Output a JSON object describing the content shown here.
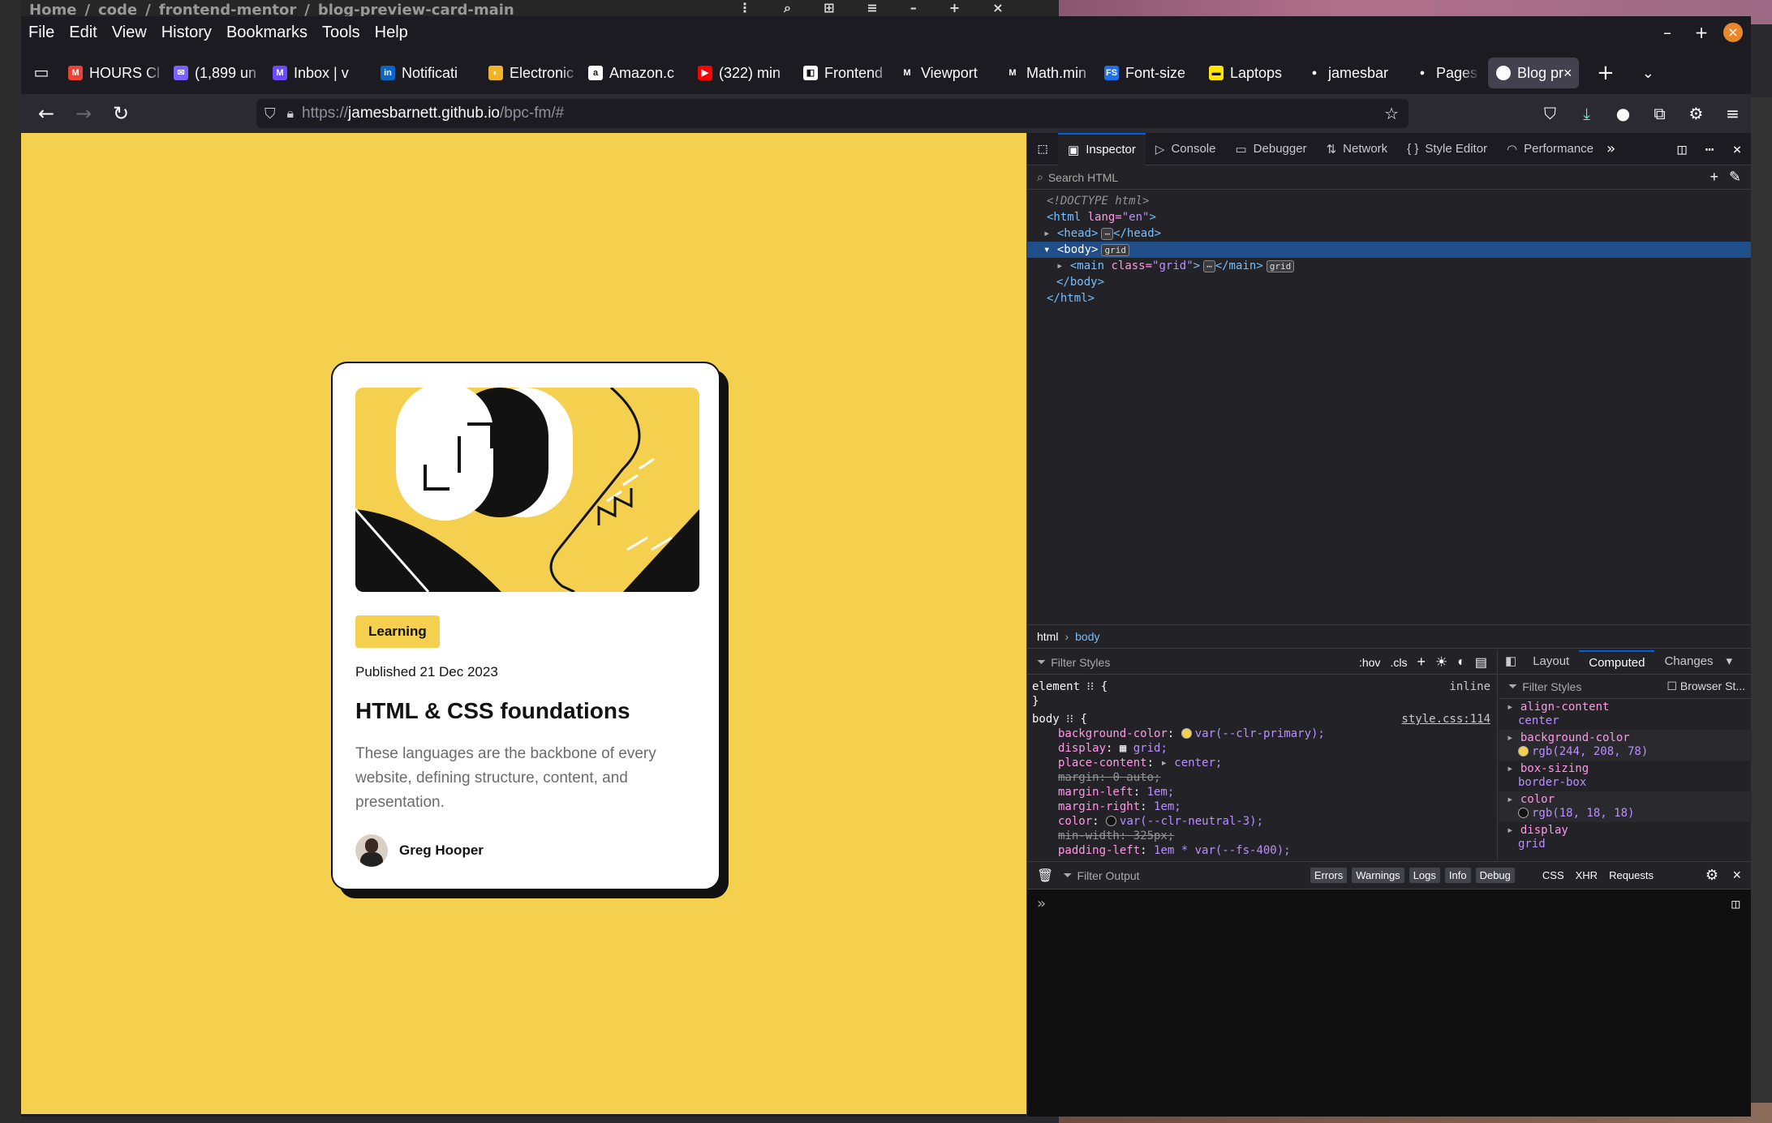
{
  "bg_path": {
    "items": [
      "Home",
      "/",
      "code",
      "/",
      "frontend-mentor",
      "/",
      "blog-preview-card-main"
    ]
  },
  "menu": [
    "File",
    "Edit",
    "View",
    "History",
    "Bookmarks",
    "Tools",
    "Help"
  ],
  "tabs": [
    {
      "label": "HOURS Cl",
      "icon": "gmail-icon",
      "color": "#ea4335",
      "glyph": "M"
    },
    {
      "label": "(1,899 un",
      "icon": "mail-icon",
      "color": "#7b61ff",
      "glyph": "✉"
    },
    {
      "label": "Inbox | v",
      "icon": "proton-icon",
      "color": "#6d4aff",
      "glyph": "M"
    },
    {
      "label": "Notificati",
      "icon": "linkedin-icon",
      "color": "#0a66c2",
      "glyph": "in"
    },
    {
      "label": "Electronic",
      "icon": "electronics-icon",
      "color": "#f0b429",
      "glyph": "◐"
    },
    {
      "label": "Amazon.c",
      "icon": "amazon-icon",
      "color": "#ffffff",
      "glyph": "a"
    },
    {
      "label": "(322) min",
      "icon": "youtube-icon",
      "color": "#ff0000",
      "glyph": "▶"
    },
    {
      "label": "Frontend",
      "icon": "frontendmentor-icon",
      "color": "#ffffff",
      "glyph": "◧"
    },
    {
      "label": "Viewport",
      "icon": "mdn-icon",
      "color": "#1c1b22",
      "glyph": "M"
    },
    {
      "label": "Math.min",
      "icon": "mdn-icon",
      "color": "#1c1b22",
      "glyph": "M"
    },
    {
      "label": "Font-size",
      "icon": "fontsize-icon",
      "color": "#1f6feb",
      "glyph": "FS"
    },
    {
      "label": "Laptops",
      "icon": "laptop-icon",
      "color": "#ffe500",
      "glyph": "▬"
    },
    {
      "label": "jamesbar",
      "icon": "github-icon",
      "color": "#1c1b22",
      "glyph": "●"
    },
    {
      "label": "Pages",
      "icon": "github-icon",
      "color": "#1c1b22",
      "glyph": "●"
    }
  ],
  "active_tab": {
    "label": "Blog pr",
    "icon": "globe-icon"
  },
  "url": {
    "prefix": "https://",
    "host": "jamesbarnett.github.io",
    "path": "/bpc-fm/#"
  },
  "card": {
    "badge": "Learning",
    "published": "Published 21 Dec 2023",
    "title": "HTML & CSS foundations",
    "description": "These languages are the backbone of every website, defining structure, content, and presentation.",
    "author": "Greg Hooper"
  },
  "devtools": {
    "tabs": [
      {
        "label": "Inspector",
        "glyph": "▣"
      },
      {
        "label": "Console",
        "glyph": "▷"
      },
      {
        "label": "Debugger",
        "glyph": "▭"
      },
      {
        "label": "Network",
        "glyph": "⇅"
      },
      {
        "label": "Style Editor",
        "glyph": "{ }"
      },
      {
        "label": "Performance",
        "glyph": "◠"
      }
    ],
    "search_placeholder": "Search HTML",
    "tree": {
      "doctype": "<!DOCTYPE html>",
      "html_open": "<html",
      "lang_attr": "lang=",
      "lang_val": "\"en\"",
      "head": "<head>",
      "head_close": "</head>",
      "body": "<body>",
      "main_open": "<main",
      "class_attr": "class=",
      "class_val": "\"grid\"",
      "main_close": "</main>",
      "body_close": "</body>",
      "html_close": "</html>",
      "pill": "grid",
      "ellipsis": "⋯"
    },
    "breadcrumb": {
      "first": "html",
      "second": "body"
    },
    "rules": {
      "filter": "Filter Styles",
      "hov": ":hov",
      "cls": ".cls",
      "element_selector": "element ⁝⁝ {",
      "element_source": "inline",
      "close": "}",
      "body_selector": "body ⁝⁝ {",
      "body_source": "style.css:114",
      "decls": [
        {
          "prop": "background-color",
          "value": "var(--clr-primary);",
          "swatch": "#f4d04e",
          "struck": false
        },
        {
          "prop": "display",
          "value": "grid;",
          "swatch": "",
          "struck": false
        },
        {
          "prop": "place-content",
          "value": "center;",
          "swatch": "",
          "struck": false
        },
        {
          "prop": "margin",
          "value": "0 auto;",
          "swatch": "",
          "struck": true
        },
        {
          "prop": "margin-left",
          "value": "1em;",
          "swatch": "",
          "struck": false
        },
        {
          "prop": "margin-right",
          "value": "1em;",
          "swatch": "",
          "struck": false
        },
        {
          "prop": "color",
          "value": "var(--clr-neutral-3);",
          "swatch": "#121212",
          "struck": false
        },
        {
          "prop": "min-width",
          "value": "325px;",
          "swatch": "",
          "struck": true
        },
        {
          "prop": "padding-left",
          "value": "1em * var(--fs-400);",
          "swatch": "",
          "struck": false
        }
      ]
    },
    "computed": {
      "tabs": [
        "Layout",
        "Computed",
        "Changes"
      ],
      "filter": "Filter Styles",
      "browser_styles": "Browser St...",
      "props": [
        {
          "name": "align-content",
          "value": "center",
          "swatch": ""
        },
        {
          "name": "background-color",
          "value": "rgb(244, 208, 78)",
          "swatch": "#f4d04e"
        },
        {
          "name": "box-sizing",
          "value": "border-box",
          "swatch": ""
        },
        {
          "name": "color",
          "value": "rgb(18, 18, 18)",
          "swatch": "#121212"
        },
        {
          "name": "display",
          "value": "grid",
          "swatch": ""
        }
      ]
    },
    "console": {
      "filter": "Filter Output",
      "levels": [
        "Errors",
        "Warnings",
        "Logs",
        "Info",
        "Debug"
      ],
      "types": [
        "CSS",
        "XHR",
        "Requests"
      ],
      "prompt": "»"
    }
  }
}
